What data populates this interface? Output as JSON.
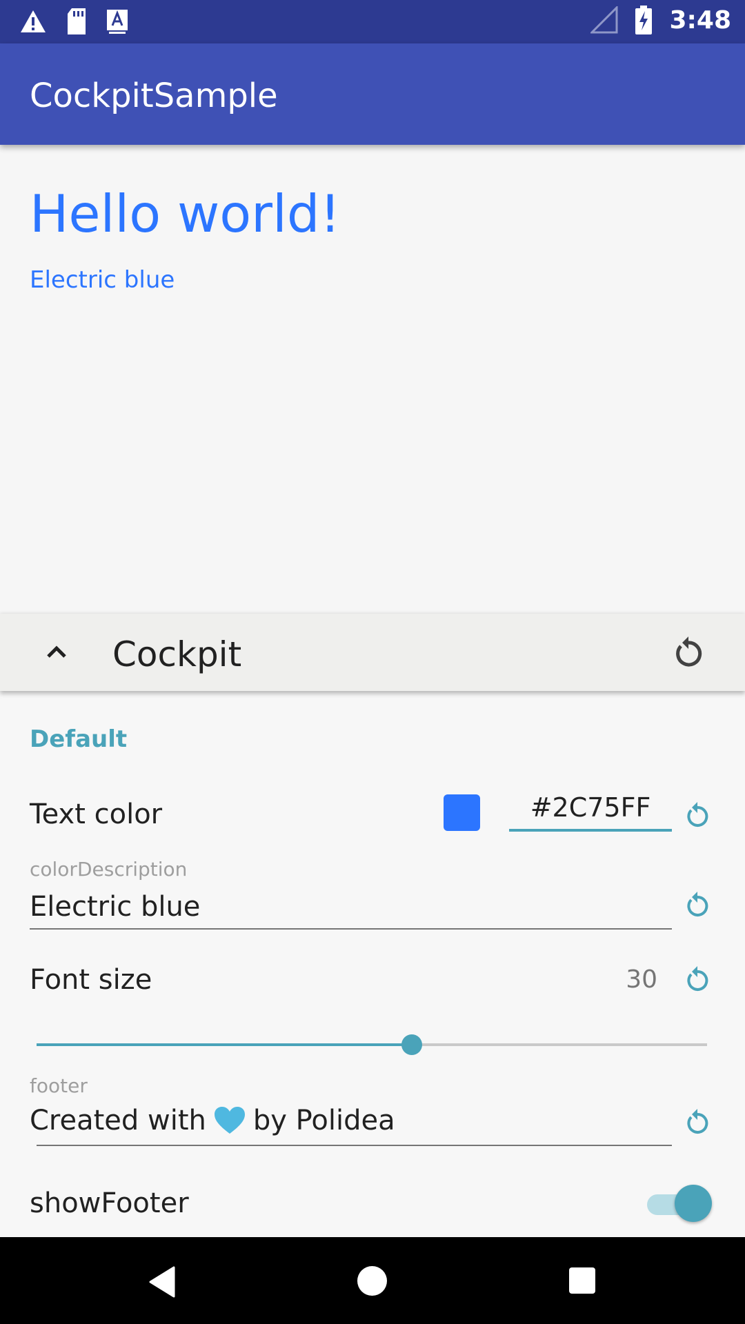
{
  "status_bar": {
    "time": "3:48",
    "icons": [
      "warning-icon",
      "sd-card-icon",
      "a-icon",
      "signal-icon",
      "battery-charging-icon"
    ]
  },
  "app_bar": {
    "title": "CockpitSample"
  },
  "content": {
    "hello": "Hello world!",
    "description": "Electric blue",
    "text_color": "#2c75ff"
  },
  "cockpit": {
    "title": "Cockpit",
    "section": "Default",
    "text_color": {
      "label": "Text color",
      "value": "#2C75FF",
      "swatch": "#2c75ff"
    },
    "color_description": {
      "label": "colorDescription",
      "value": "Electric blue"
    },
    "font_size": {
      "label": "Font size",
      "value": "30",
      "slider_fraction": 0.56
    },
    "footer": {
      "label": "footer",
      "prefix": "Created with",
      "suffix": "by Polidea"
    },
    "show_footer": {
      "label": "showFooter",
      "enabled": true
    },
    "accent": "#4aa3b9"
  },
  "nav_bar": {
    "icons": [
      "back-icon",
      "home-icon",
      "recents-icon"
    ]
  }
}
